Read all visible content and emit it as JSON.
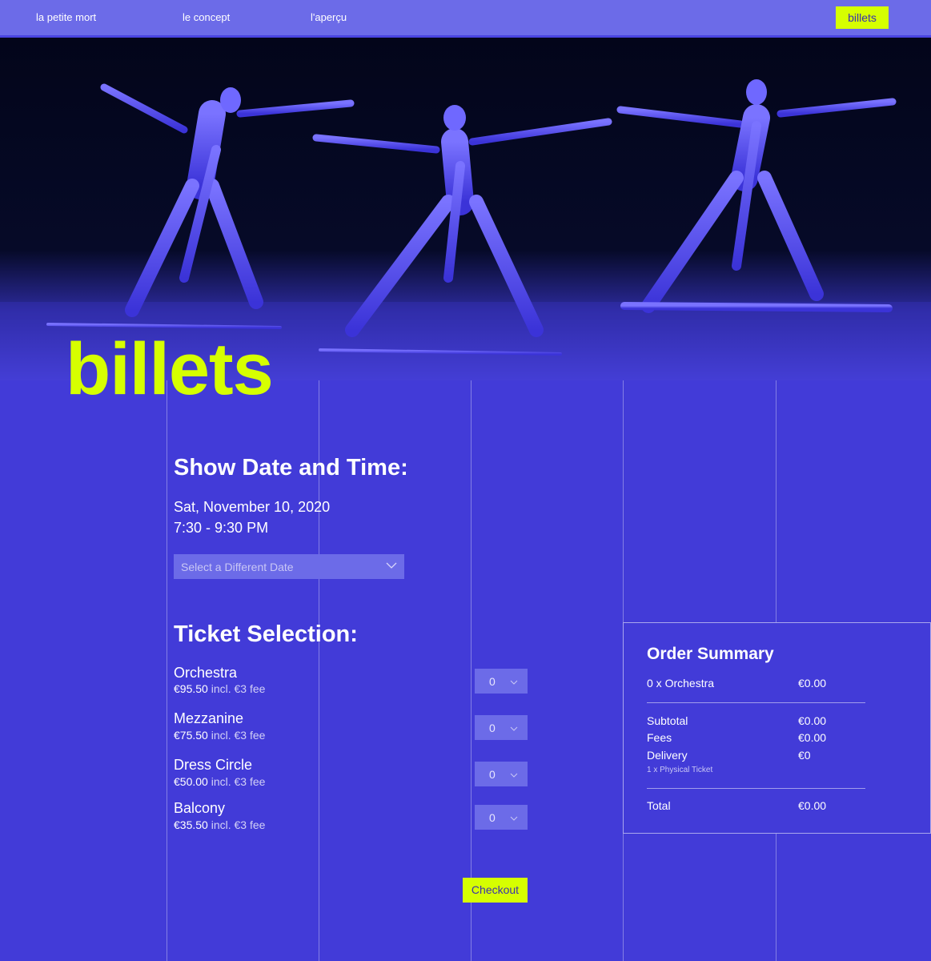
{
  "nav": {
    "brand": "la petite mort",
    "concept": "le concept",
    "apercu": "l'aperçu",
    "cta": "billets"
  },
  "colors": {
    "background": "#423bd8",
    "nav": "#6c6be8",
    "accent": "#d6ff00"
  },
  "hero": {
    "image": "dancers-photo",
    "title": "billets"
  },
  "show": {
    "heading": "Show Date and Time:",
    "date": "Sat, November 10, 2020",
    "time": "7:30 - 9:30 PM",
    "select_placeholder": "Select a Different Date"
  },
  "tickets": {
    "heading": "Ticket Selection:",
    "items": [
      {
        "name": "Orchestra",
        "price": "€95.50",
        "fee": "incl. €3 fee",
        "qty": "0"
      },
      {
        "name": "Mezzanine",
        "price": "€75.50",
        "fee": "incl. €3 fee",
        "qty": "0"
      },
      {
        "name": "Dress Circle",
        "price": "€50.00",
        "fee": "incl. €3 fee",
        "qty": "0"
      },
      {
        "name": "Balcony",
        "price": "€35.50",
        "fee": "incl. €3 fee",
        "qty": "0"
      }
    ],
    "checkout_label": "Checkout"
  },
  "summary": {
    "title": "Order Summary",
    "line_item": "0 x Orchestra",
    "line_item_value": "€0.00",
    "subtotal_label": "Subtotal",
    "subtotal_value": "€0.00",
    "fees_label": "Fees",
    "fees_value": "€0.00",
    "delivery_label": "Delivery",
    "delivery_value": "€0",
    "delivery_note": "1 x Physical Ticket",
    "total_label": "Total",
    "total_value": "€0.00"
  }
}
